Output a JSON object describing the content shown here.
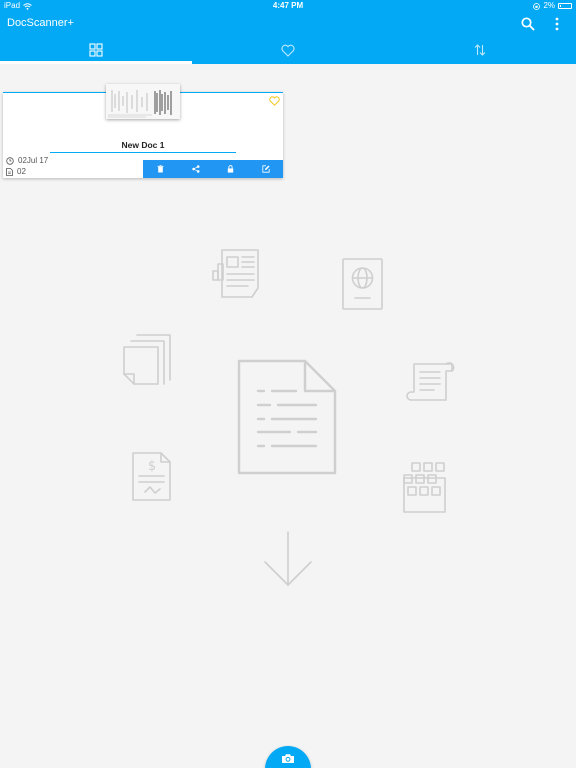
{
  "status_bar": {
    "device": "iPad",
    "time": "4:47 PM",
    "battery": "2%"
  },
  "app_bar": {
    "title": "DocScanner+",
    "icons": [
      "search-icon",
      "more-vert-icon"
    ]
  },
  "tabs": [
    {
      "icon": "grid-icon",
      "selected": true
    },
    {
      "icon": "heart-icon",
      "selected": false
    },
    {
      "icon": "sort-icon",
      "selected": false
    }
  ],
  "document": {
    "name": "New Doc 1",
    "date": "02Jul 17",
    "pages": "02",
    "favorite": true,
    "actions": [
      "trash-icon",
      "share-icon",
      "lock-icon",
      "edit-icon"
    ]
  },
  "colors": {
    "primary": "#03a9f4",
    "action_bar": "#2196f3",
    "favorite": "#f5c518",
    "background": "#f4f4f4",
    "illustration": "#cfcfcf"
  },
  "fab": {
    "icon": "camera-icon"
  }
}
